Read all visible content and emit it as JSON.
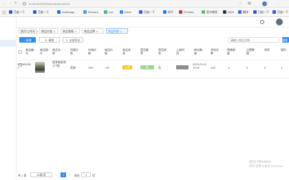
{
  "browser": {
    "url": "localhost:8080/#/goods/goodsList",
    "bookmarks": [
      {
        "label": "百度一下",
        "color": "#3355dd"
      },
      {
        "label": "百度一下",
        "color": "#3355dd"
      },
      {
        "label": "AntDesign",
        "color": "#1a73e8"
      },
      {
        "label": "Element",
        "color": "#409eff"
      },
      {
        "label": "vue",
        "color": "#41b883"
      },
      {
        "label": "iView",
        "color": "#2d8cf0"
      },
      {
        "label": "百度一下",
        "color": "#3355dd"
      },
      {
        "label": "知乎",
        "color": "#0084ff"
      },
      {
        "label": "ECharts",
        "color": "#c23531"
      },
      {
        "label": "菜鸟教程",
        "color": "#5fb878"
      },
      {
        "label": "MDN",
        "color": "#333333"
      },
      {
        "label": "翻译",
        "color": "#3367d6"
      },
      {
        "label": "百度一下",
        "color": "#3355dd"
      },
      {
        "label": "百度一下",
        "color": "#3355dd"
      }
    ],
    "profile_initial": "L"
  },
  "tabs": [
    {
      "label": "首页/工作台"
    },
    {
      "label": "商品分类"
    },
    {
      "label": "商品规格"
    },
    {
      "label": "商品品牌"
    },
    {
      "label": "商品列表"
    }
  ],
  "toolbar": {
    "add_label": "+ 新增",
    "delete_label": "删除",
    "export_label": "全部导出",
    "search_placeholder": "请输入商品名称",
    "search_label": "搜索"
  },
  "table": {
    "headers": [
      "商品编号",
      "商品图片",
      "商品名称",
      "所属分类",
      "市场价格",
      "商品价格",
      "商品状态",
      "是否推荐",
      "是否热卖",
      "上架时间",
      "库存数量",
      "浏览次数",
      "销售数量",
      "点赞数量",
      "排序",
      "操作"
    ],
    "rows": [
      {
        "id": "1700000001",
        "name": "夏季新款男士T恤",
        "category": "男装",
        "market_price": "199",
        "price": "99",
        "status": "上架",
        "recommend": "是",
        "hot": "否",
        "time": "2023-09-01 10:00",
        "stock": "100",
        "views": "0",
        "sales": "0",
        "likes": "0",
        "sort": "1"
      }
    ]
  },
  "pager": {
    "total": "共 1 条",
    "page_size": "10条/页",
    "current_page": "1",
    "goto_label": "前往",
    "goto_value": "1",
    "page_unit": "页"
  },
  "watermark": {
    "line1": "激活 Windows",
    "line2": "转到“设置”以激活 Windows。"
  },
  "colors": {
    "accent": "#2d8cf0",
    "status_on": "#f5c518",
    "recommend": "#9ed88d",
    "hot": "#8d8d8d"
  }
}
